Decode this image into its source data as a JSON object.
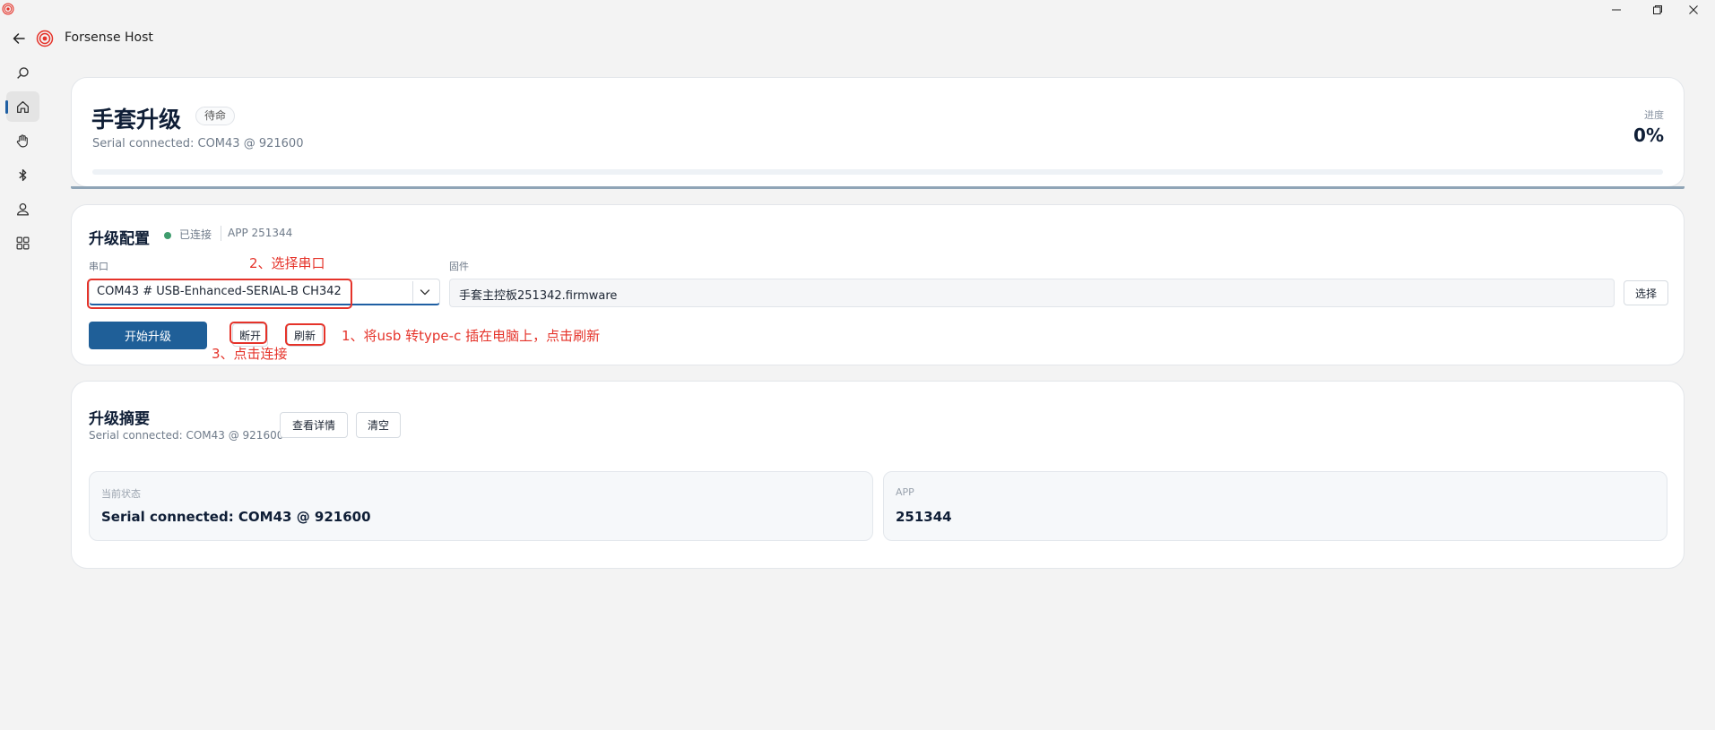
{
  "window": {
    "title": "Forsense Host",
    "controls": [
      "minimize-icon",
      "restore-icon",
      "close-icon"
    ]
  },
  "header": {
    "back_icon": "arrow-left-icon",
    "app_title": "Forsense Host"
  },
  "sidebar": {
    "items": [
      {
        "icon": "search-icon",
        "active": false
      },
      {
        "icon": "home-icon",
        "active": true
      },
      {
        "icon": "hand-icon",
        "active": false
      },
      {
        "icon": "bluetooth-icon",
        "active": false
      },
      {
        "icon": "user-icon",
        "active": false
      },
      {
        "icon": "apps-grid-icon",
        "active": false
      }
    ]
  },
  "hero": {
    "title": "手套升级",
    "badge": "待命",
    "subtitle": "Serial connected: COM43 @ 921600",
    "progress_label": "进度",
    "progress_value": "0%",
    "progress_fraction": 0
  },
  "config": {
    "title": "升级配置",
    "status": "已连接",
    "app_version": "APP 251344",
    "port_label": "串口",
    "port_value": "COM43 # USB-Enhanced-SERIAL-B CH342",
    "firmware_label": "固件",
    "firmware_value": "手套主控板251342.firmware",
    "choose_label": "选择",
    "start_label": "开始升级",
    "disconnect_label": "断开",
    "refresh_label": "刷新"
  },
  "annotations": {
    "step1": "1、将usb 转type-c 插在电脑上，点击刷新",
    "step2": "2、选择串口",
    "step3": "3、点击连接",
    "color": "#e5332a"
  },
  "summary": {
    "title": "升级摘要",
    "subtitle": "Serial connected: COM43 @ 921600",
    "details_label": "查看详情",
    "clear_label": "清空",
    "state_label": "当前状态",
    "state_value": "Serial connected: COM43 @ 921600",
    "app_label": "APP",
    "app_value": "251344"
  },
  "colors": {
    "accent": "#1f5f98",
    "status_green": "#3f9c6d",
    "background": "#f3f3f3"
  }
}
